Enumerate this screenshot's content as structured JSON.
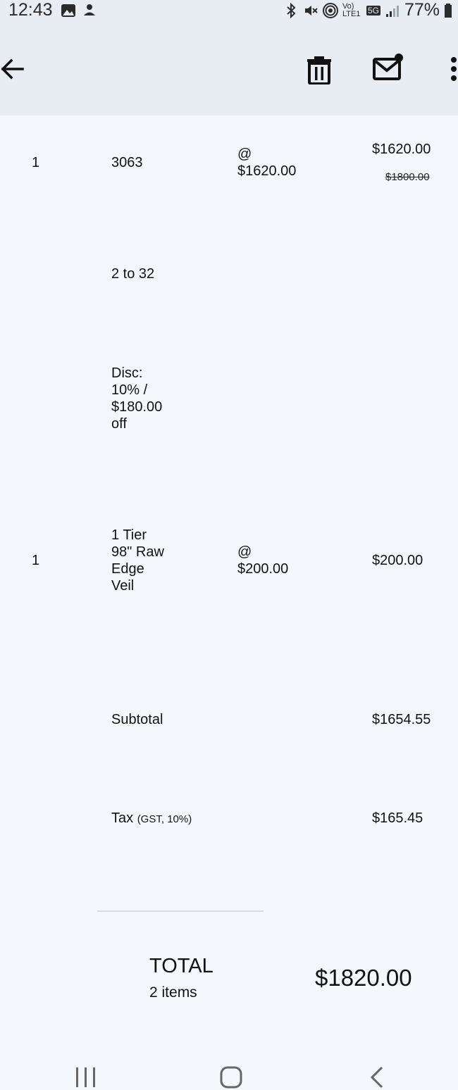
{
  "status": {
    "time": "12:43",
    "battery": "77%",
    "network": "5G",
    "volte": "Vo) LTE1"
  },
  "items": [
    {
      "qty": "1",
      "name": "3063",
      "at": "@",
      "unit_price": "$1620.00",
      "line_total": "$1620.00",
      "original_total": "$1800.00",
      "size": "2 to 32",
      "discount_lines": [
        "Disc:",
        "10% /",
        "$180.00",
        "off"
      ]
    },
    {
      "qty": "1",
      "name_lines": [
        "1 Tier",
        "98\" Raw",
        "Edge",
        "Veil"
      ],
      "at": "@",
      "unit_price": "$200.00",
      "line_total": "$200.00"
    }
  ],
  "summary": {
    "subtotal_label": "Subtotal",
    "subtotal_value": "$1654.55",
    "tax_label": "Tax",
    "tax_detail": "(GST, 10%)",
    "tax_value": "$165.45",
    "total_label": "TOTAL",
    "item_count": "2 items",
    "total_value": "$1820.00"
  },
  "icons": {
    "back": "arrow-left-icon",
    "delete": "trash-icon",
    "email": "mail-icon",
    "more": "more-vert-icon",
    "recents": "recents-icon",
    "home": "home-icon",
    "nav_back": "chevron-back-icon"
  }
}
